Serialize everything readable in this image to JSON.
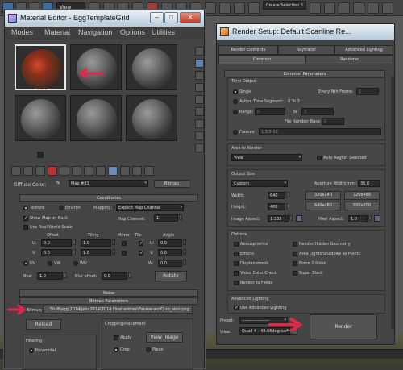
{
  "toolbar": {
    "view_select": "View",
    "selection_set": "Create Selection S"
  },
  "material_editor": {
    "title": "Material Editor - EggTemplateGrid",
    "menu": [
      "Modes",
      "Material",
      "Navigation",
      "Options",
      "Utilities"
    ],
    "material_name": "Map #81",
    "material_type": "Bitmap",
    "diffuse_label": "Diffuse Color:",
    "coordinates": {
      "header": "Coordinates",
      "texture": "Texture",
      "environ": "Environ",
      "mapping_label": "Mapping:",
      "mapping_value": "Explicit Map Channel",
      "show_map_on_back": "Show Map on Back",
      "map_channel_label": "Map Channel:",
      "map_channel_value": "1",
      "real_world": "Use Real-World Scale",
      "col_offset": "Offset",
      "col_tiling": "Tiling",
      "col_mirror": "Mirror",
      "col_tile": "Tile",
      "col_angle": "Angle",
      "u_label": "U:",
      "v_label": "V:",
      "u_offset": "0.0",
      "v_offset": "0.0",
      "u_tiling": "1.0",
      "v_tiling": "1.0",
      "u_angle_label": "U:",
      "u_angle": "0.0",
      "v_angle_label": "V:",
      "v_angle": "0.0",
      "w_angle_label": "W:",
      "w_angle": "0.0",
      "uv": "UV",
      "vw": "VW",
      "wu": "WU",
      "blur_label": "Blur:",
      "blur_value": "1.0",
      "blur_offset_label": "Blur offset:",
      "blur_offset_value": "0.0",
      "rotate": "Rotate"
    },
    "noise_header": "Noise",
    "bitmap_params": {
      "header": "Bitmap Parameters",
      "bitmap_label": "Bitmap:",
      "bitmap_path": "...Stuff\\egg\\2014\\jens2014\\2014 Final entries\\Faeree-wolf2-rb_skin.png",
      "reload": "Reload",
      "cropping_header": "Cropping/Placement",
      "apply": "Apply",
      "view_image": "View Image",
      "filtering_label": "Filtering",
      "pyramidal": "Pyramidal",
      "crop": "Crop",
      "place": "Place"
    }
  },
  "render_setup": {
    "title": "Render Setup: Default Scanline Re...",
    "tabs_row1": [
      "Render Elements",
      "Raytracer",
      "Advanced Lighting"
    ],
    "tabs_row2": [
      "Common",
      "Renderer"
    ],
    "common_params": "Common Parameters",
    "time_output": {
      "header": "Time Output",
      "single": "Single",
      "every_nth": "Every Nth Frame:",
      "every_nth_value": "1",
      "active_segment": "Active Time Segment:",
      "active_range": "0 To 3",
      "range": "Range:",
      "range_from": "0",
      "range_to_label": "To",
      "range_to": "3",
      "file_number_base": "File Number Base:",
      "file_number_value": "0",
      "frames": "Frames:",
      "frames_value": "1,3,5-12"
    },
    "area_to_render": {
      "header": "Area to Render",
      "value": "View",
      "auto_region": "Auto Region Selected"
    },
    "output_size": {
      "header": "Output Size",
      "preset": "Custom",
      "aperture_label": "Aperture Width(mm):",
      "aperture_value": "36.0",
      "width_label": "Width:",
      "width_value": "640",
      "height_label": "Height:",
      "height_value": "480",
      "presets": [
        "320x240",
        "720x486",
        "640x480",
        "800x600"
      ],
      "image_aspect_label": "Image Aspect:",
      "image_aspect_value": "1.333",
      "pixel_aspect_label": "Pixel Aspect:",
      "pixel_aspect_value": "1.0"
    },
    "options": {
      "header": "Options",
      "items_left": [
        "Atmospherics",
        "Effects",
        "Displacement",
        "Video Color Check",
        "Render to Fields"
      ],
      "items_right": [
        "Render Hidden Geometry",
        "Area Lights/Shadows as Points",
        "Force 2-Sided",
        "Super Black"
      ]
    },
    "advanced_lighting": {
      "header": "Advanced Lighting",
      "use": "Use Advanced Lighting"
    },
    "preset_label": "Preset:",
    "preset_value": "-------------------",
    "view_label": "View:",
    "view_value": "Quad 4 - 48.66deg car",
    "render_button": "Render"
  },
  "colors": {
    "annotation_arrow": "#e0284a",
    "titlebar": "#cfdce8"
  }
}
